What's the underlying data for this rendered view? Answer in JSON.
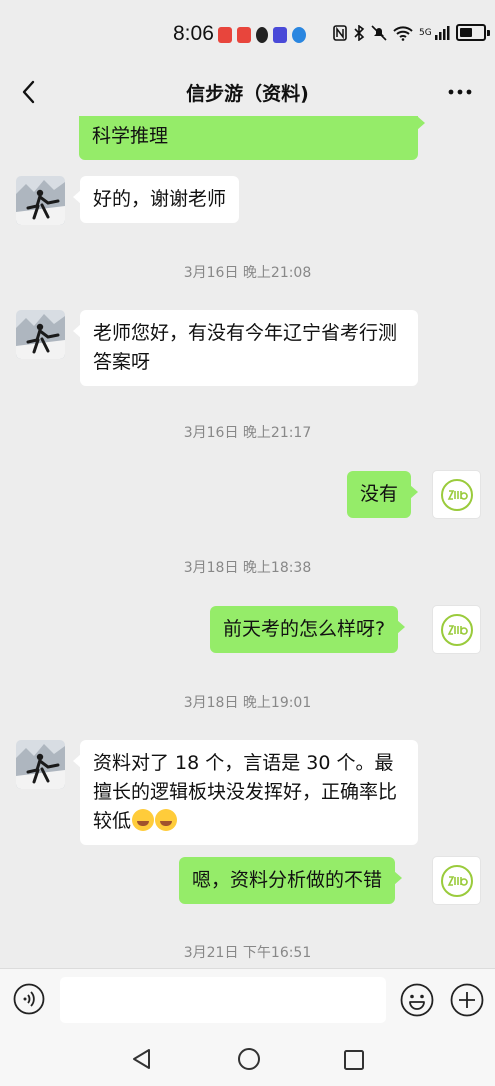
{
  "status_bar": {
    "time": "8:06",
    "network": "5G"
  },
  "header": {
    "title": "信步游（资料)",
    "back_icon": "chevron-left-icon",
    "more_icon": "more-dots-icon"
  },
  "messages": [
    {
      "type": "sent_partial",
      "text": "科学推理"
    },
    {
      "type": "received",
      "text": "好的，谢谢老师"
    },
    {
      "type": "time",
      "text": "3月16日 晚上21:08"
    },
    {
      "type": "received",
      "text": "老师您好，有没有今年辽宁省考行测答案呀"
    },
    {
      "type": "time",
      "text": "3月16日 晚上21:17"
    },
    {
      "type": "sent",
      "text": "没有"
    },
    {
      "type": "time",
      "text": "3月18日 晚上18:38"
    },
    {
      "type": "sent",
      "text": "前天考的怎么样呀?"
    },
    {
      "type": "time",
      "text": "3月18日 晚上19:01"
    },
    {
      "type": "received",
      "text": "资料对了 18 个，言语是 30 个。最擅长的逻辑板块没发挥好，正确率比较低",
      "emoji": [
        "laugh-cry-emoji",
        "laugh-cry-emoji"
      ]
    },
    {
      "type": "sent",
      "text": "嗯，资料分析做的不错"
    },
    {
      "type": "time",
      "text": "3月21日 下午16:51"
    }
  ],
  "avatars": {
    "received": "user-avatar-photo",
    "sent": "teacher-avatar-logo"
  },
  "input_bar": {
    "value": "",
    "placeholder": "",
    "voice_icon": "voice-icon",
    "emoji_icon": "smiley-icon",
    "plus_icon": "plus-circle-icon"
  },
  "nav": {
    "back_icon": "nav-back-icon",
    "home_icon": "nav-home-icon",
    "recent_icon": "nav-recent-icon"
  },
  "colors": {
    "background": "#ededed",
    "sent_bubble": "#95ec69",
    "received_bubble": "#ffffff",
    "time_text": "#888888"
  }
}
